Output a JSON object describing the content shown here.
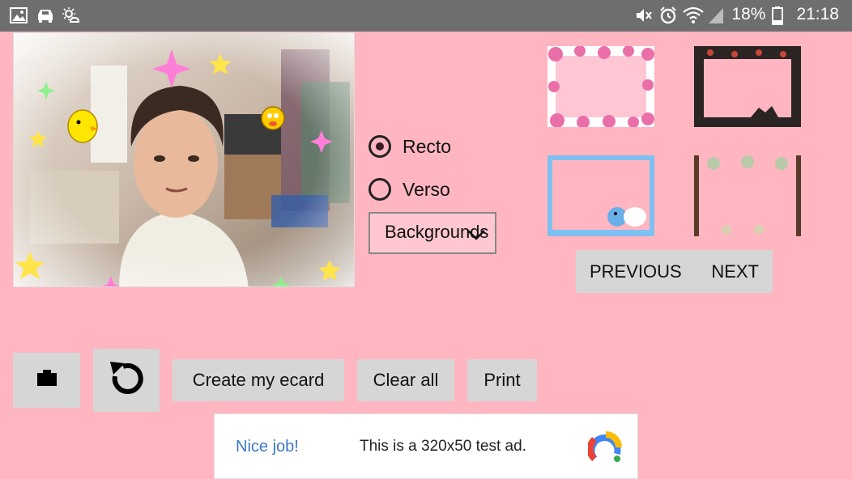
{
  "status_bar": {
    "left_icons": [
      "image-icon",
      "car-icon",
      "weather-icon"
    ],
    "right_icons": [
      "mute-icon",
      "alarm-icon",
      "wifi-icon",
      "signal-icon"
    ],
    "battery": "18%",
    "time": "21:18"
  },
  "side": {
    "radio_recto": "Recto",
    "radio_verso": "Verso",
    "selected": "Recto",
    "dropdown_value": "Backgrounds"
  },
  "thumbnails": [
    {
      "name": "pink-flowers-frame"
    },
    {
      "name": "dark-floral-frame"
    },
    {
      "name": "blue-cartoon-frame"
    },
    {
      "name": "vintage-frame"
    }
  ],
  "nav": {
    "previous": "PREVIOUS",
    "next": "NEXT"
  },
  "toolbar": {
    "camera_icon": "camera-icon",
    "rotate_icon": "rotate-icon",
    "create": "Create my ecard",
    "clear": "Clear all",
    "print": "Print"
  },
  "ad": {
    "title": "Nice job!",
    "text": "This is a 320x50 test ad."
  },
  "colors": {
    "background": "#ffb6c1",
    "button": "#d6d6d6",
    "status_bar": "#6e6e6e",
    "ad_title": "#3c78c8"
  }
}
